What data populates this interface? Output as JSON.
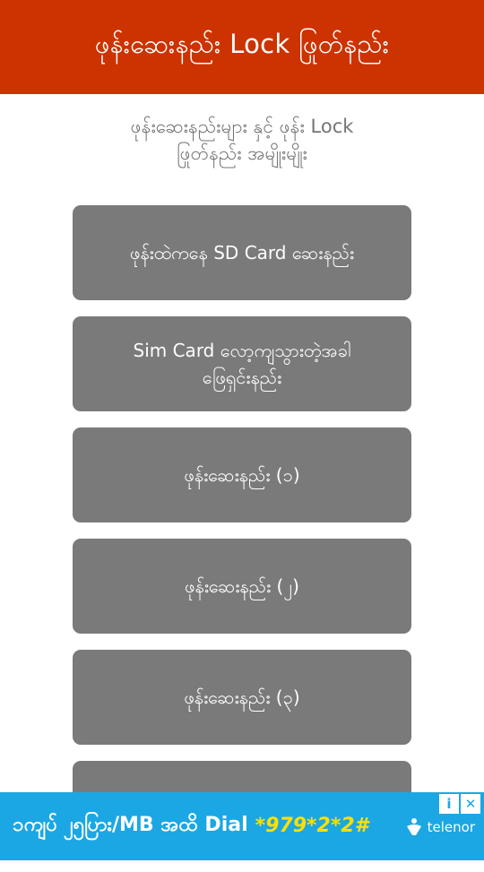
{
  "app_bar": {
    "title": "ဖုန်းဆေးနည်း Lock ဖြုတ်နည်း",
    "color": "#cc3300"
  },
  "subtitle": {
    "line1": "ဖုန်းဆေးနည်းများ နှင့် ဖုန်း Lock",
    "line2": "ဖြုတ်နည်း အမျိုးမျိုး"
  },
  "menu": {
    "items": [
      {
        "line1": "ဖုန်းထဲကနေ SD Card ဆေးနည်း",
        "line2": ""
      },
      {
        "line1": "Sim Card လော့ကျသွားတဲ့အခါ",
        "line2": "ဖြေရှင်းနည်း"
      },
      {
        "line1": "ဖုန်းဆေးနည်း (၁)",
        "line2": ""
      },
      {
        "line1": "ဖုန်းဆေးနည်း (၂)",
        "line2": ""
      },
      {
        "line1": "ဖုန်းဆေးနည်း (၃)",
        "line2": ""
      },
      {
        "line1": "",
        "line2": ""
      }
    ],
    "button_color": "#7a7a7a"
  },
  "ad": {
    "text": "၁ကျပ် ၂၅ပြား/MB အထိ Dial",
    "number": "*979*2*2#",
    "brand": "telenor",
    "info_icon": "info-icon",
    "close_icon": "close-icon",
    "background": "#1ba7e4"
  }
}
